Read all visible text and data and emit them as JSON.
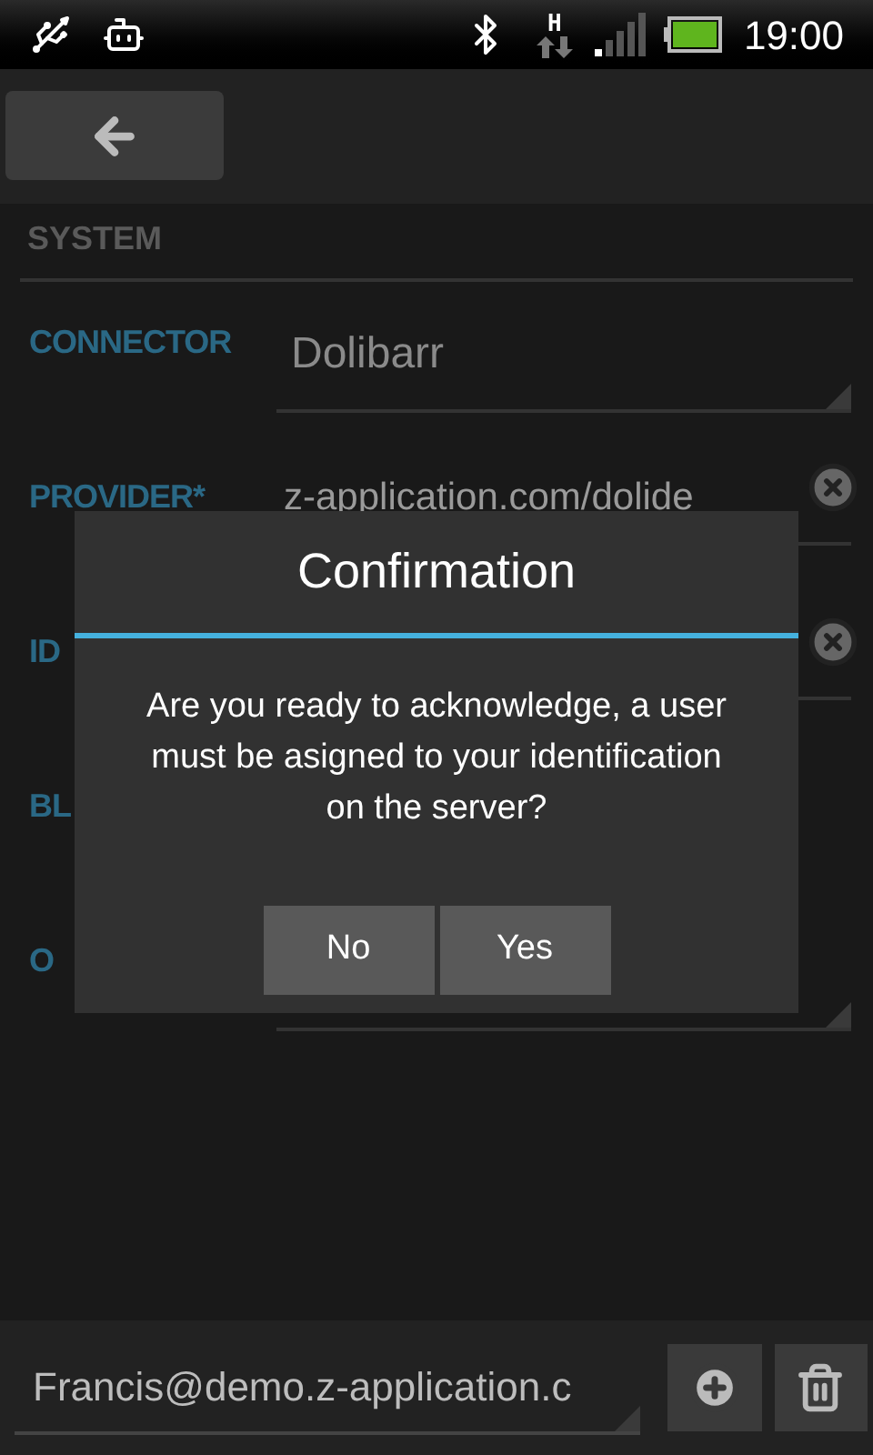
{
  "status_bar": {
    "network_type": "H",
    "time": "19:00"
  },
  "section": {
    "title": "SYSTEM"
  },
  "fields": [
    {
      "label": "CONNECTOR",
      "kind": "spinner",
      "value": "Dolibarr"
    },
    {
      "label": "PROVIDER*",
      "kind": "text",
      "value": "z-application.com/dolide"
    },
    {
      "label": "ID",
      "kind": "text"
    },
    {
      "label": "BL",
      "kind": "blank"
    },
    {
      "label": "O",
      "kind": "spinner"
    }
  ],
  "dialog": {
    "title": "Confirmation",
    "message": "Are you ready to acknowledge, a user must be asigned to your identification on the server?",
    "buttons": [
      "No",
      "Yes"
    ]
  },
  "account": {
    "value": "Francis@demo.z-application.c"
  }
}
